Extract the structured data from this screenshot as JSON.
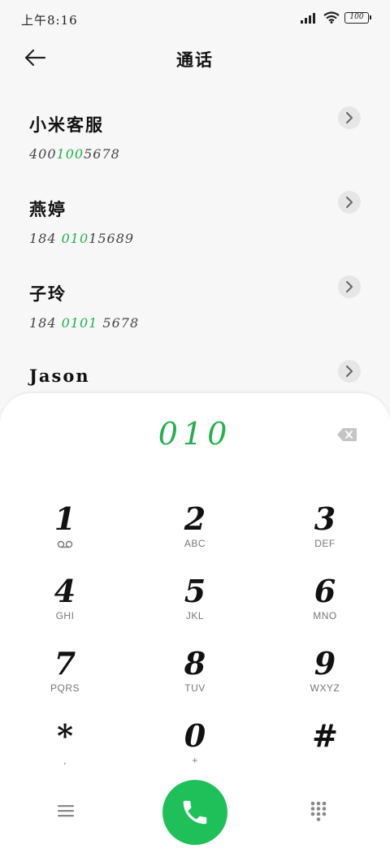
{
  "status": {
    "time": "上午8:16",
    "battery": "100",
    "icons": [
      "signal-icon",
      "wifi-icon",
      "battery-icon"
    ]
  },
  "header": {
    "title": "通话",
    "back_icon": "arrow-left-icon"
  },
  "contacts": [
    {
      "name": "小米客服",
      "number_prefix": "400",
      "number_match": "100",
      "number_suffix": "5678"
    },
    {
      "name": "燕婷",
      "number_prefix": "184 ",
      "number_match": "010",
      "number_suffix": "15689"
    },
    {
      "name": "子玲",
      "number_prefix": "184 ",
      "number_match": "0101",
      "number_suffix": " 5678"
    },
    {
      "name": "Jason",
      "number_prefix": "",
      "number_match": "",
      "number_suffix": ""
    }
  ],
  "dialer": {
    "input": "010",
    "backspace_icon": "backspace-icon",
    "keys": [
      {
        "digit": "1",
        "sub": ""
      },
      {
        "digit": "2",
        "sub": "ABC"
      },
      {
        "digit": "3",
        "sub": "DEF"
      },
      {
        "digit": "4",
        "sub": "GHI"
      },
      {
        "digit": "5",
        "sub": "JKL"
      },
      {
        "digit": "6",
        "sub": "MNO"
      },
      {
        "digit": "7",
        "sub": "PQRS"
      },
      {
        "digit": "8",
        "sub": "TUV"
      },
      {
        "digit": "9",
        "sub": "WXYZ"
      },
      {
        "digit": "*",
        "sub": ","
      },
      {
        "digit": "0",
        "sub": "+"
      },
      {
        "digit": "#",
        "sub": ""
      }
    ]
  },
  "colors": {
    "accent": "#22b14c",
    "call_button": "#1fc05a"
  }
}
